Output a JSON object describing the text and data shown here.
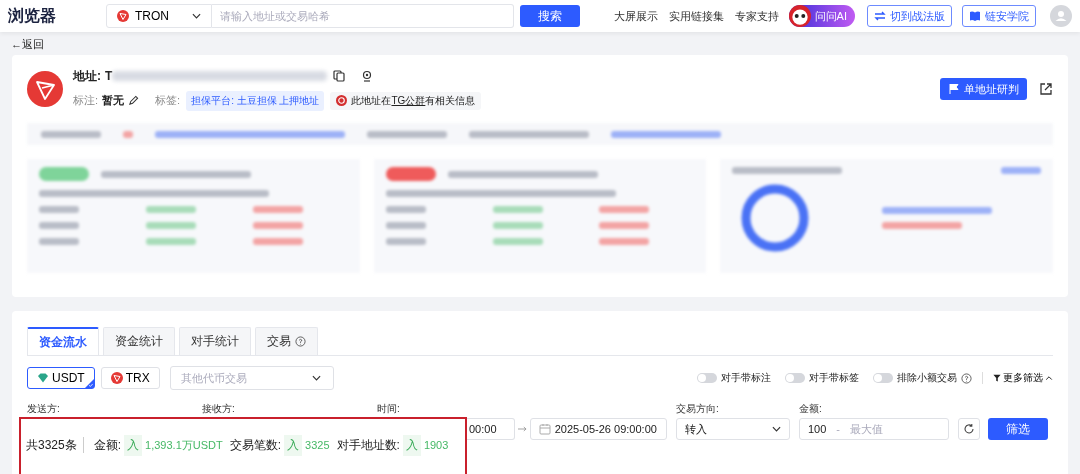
{
  "header": {
    "logo": "浏览器",
    "chain": "TRON",
    "search_placeholder": "请输入地址或交易哈希",
    "search_button": "搜索",
    "links": [
      "大屏展示",
      "实用链接集",
      "专家支持"
    ],
    "ai_button": "问问AI",
    "switch_button": "切到战法版",
    "academy_button": "链安学院"
  },
  "back": "←返回",
  "address": {
    "label": "地址:",
    "value": "T",
    "remark_label": "标注:",
    "remark": "暂无",
    "tag_label": "标签:",
    "tag": "担保平台: 土豆担保 上押地址",
    "notice_before": "此地址在",
    "notice_link": "TG公群",
    "notice_after": "有相关信息",
    "research_button": "单地址研判"
  },
  "tabs": [
    {
      "label": "资金流水",
      "selected": true,
      "has_help": false
    },
    {
      "label": "资金统计",
      "selected": false,
      "has_help": false
    },
    {
      "label": "对手统计",
      "selected": false,
      "has_help": false
    },
    {
      "label": "交易",
      "selected": false,
      "has_help": true
    }
  ],
  "tokens": [
    {
      "label": "USDT",
      "selected": true,
      "kind": "usdt"
    },
    {
      "label": "TRX",
      "selected": false,
      "kind": "trx"
    }
  ],
  "other_token_placeholder": "其他代币交易",
  "toggles": [
    {
      "label": "对手带标注",
      "on": false,
      "has_help": false
    },
    {
      "label": "对手带标签",
      "on": false,
      "has_help": false
    },
    {
      "label": "排除小额交易",
      "on": false,
      "has_help": true
    }
  ],
  "more_filters": "更多筛选",
  "filters": {
    "sender_label": "发送方:",
    "receiver_label": "接收方:",
    "time_label": "时间:",
    "time_start": "00:00",
    "time_end": "2025-05-26 09:00:00",
    "direction_label": "交易方向:",
    "direction": "转入",
    "amount_label": "金额:",
    "amount_min": "100",
    "amount_sep": "-",
    "amount_max_placeholder": "最大值",
    "filter_button": "筛选"
  },
  "summary": {
    "total": "共3325条",
    "items": [
      {
        "label": "金额:",
        "direction": "入",
        "value": "1,393.1万USDT"
      },
      {
        "label": "交易笔数:",
        "direction": "入",
        "value": "3325"
      },
      {
        "label": "对手地址数:",
        "direction": "入",
        "value": "1903"
      }
    ]
  }
}
